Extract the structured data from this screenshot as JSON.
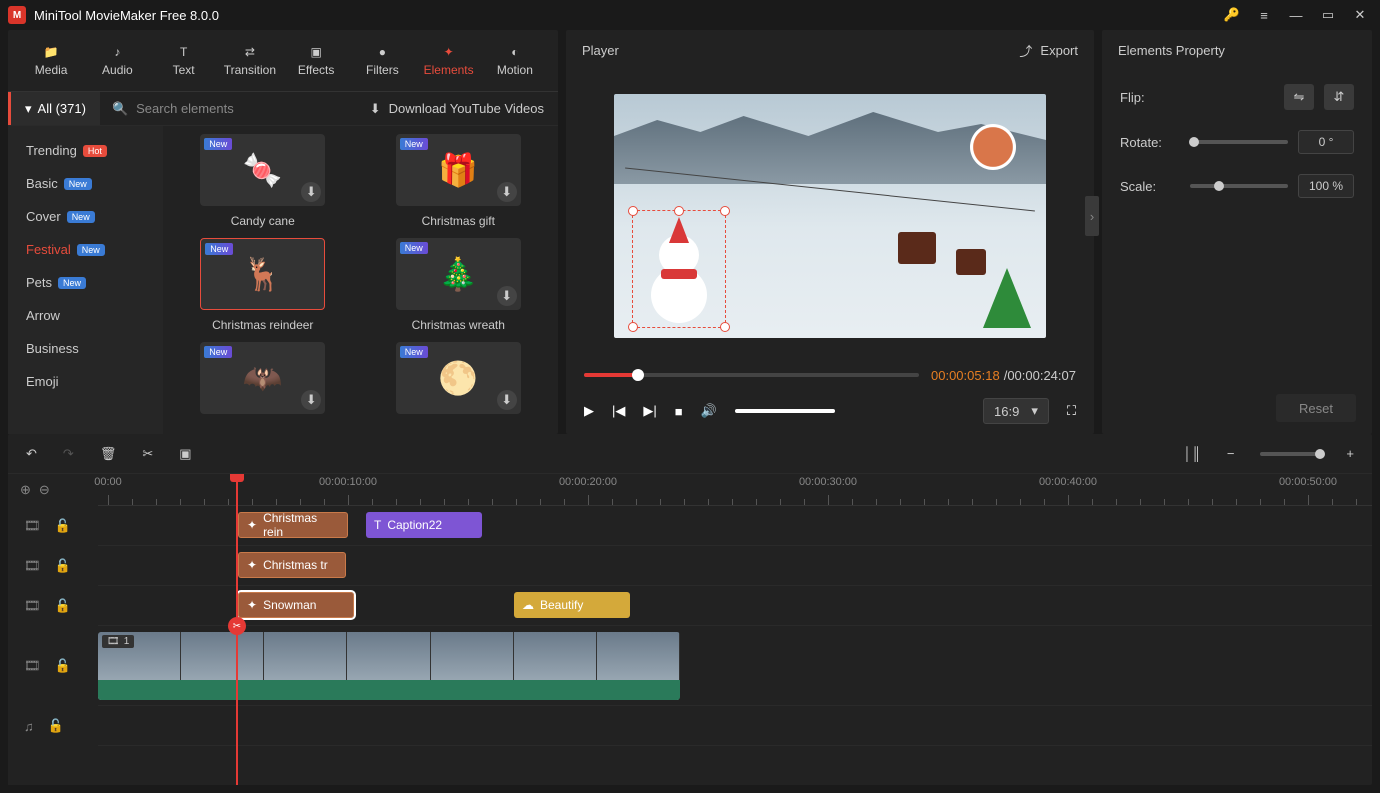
{
  "title": "MiniTool MovieMaker Free 8.0.0",
  "topnav": [
    "Media",
    "Audio",
    "Text",
    "Transition",
    "Effects",
    "Filters",
    "Elements",
    "Motion"
  ],
  "topnav_active": 6,
  "all_label": "All (371)",
  "search_placeholder": "Search elements",
  "download_yt": "Download YouTube Videos",
  "categories": [
    {
      "label": "Trending",
      "badge": "Hot"
    },
    {
      "label": "Basic",
      "badge": "New"
    },
    {
      "label": "Cover",
      "badge": "New"
    },
    {
      "label": "Festival",
      "badge": "New"
    },
    {
      "label": "Pets",
      "badge": "New"
    },
    {
      "label": "Arrow",
      "badge": null
    },
    {
      "label": "Business",
      "badge": null
    },
    {
      "label": "Emoji",
      "badge": null
    }
  ],
  "category_active": 3,
  "elements": [
    {
      "label": "Candy cane",
      "new": true,
      "dl": true
    },
    {
      "label": "Christmas gift",
      "new": true,
      "dl": true
    },
    {
      "label": "Christmas reindeer",
      "new": true,
      "dl": false,
      "selected": true
    },
    {
      "label": "Christmas wreath",
      "new": true,
      "dl": true
    },
    {
      "label": "",
      "new": true,
      "dl": true
    },
    {
      "label": "",
      "new": true,
      "dl": true
    }
  ],
  "player_title": "Player",
  "export_label": "Export",
  "time_current": "00:00:05:18",
  "time_total": "00:00:24:07",
  "aspect": "16:9",
  "props_title": "Elements Property",
  "flip_label": "Flip:",
  "rotate_label": "Rotate:",
  "rotate_value": "0 °",
  "scale_label": "Scale:",
  "scale_value": "100 %",
  "reset_label": "Reset",
  "ruler": [
    "00:00",
    "00:00:10:00",
    "00:00:20:00",
    "00:00:30:00",
    "00:00:40:00",
    "00:00:50:00"
  ],
  "clips": {
    "t1a": "Christmas rein",
    "t1b": "Caption22",
    "t2": "Christmas tr",
    "t3a": "Snowman",
    "t3b": "Beautify",
    "vnum": "1"
  }
}
